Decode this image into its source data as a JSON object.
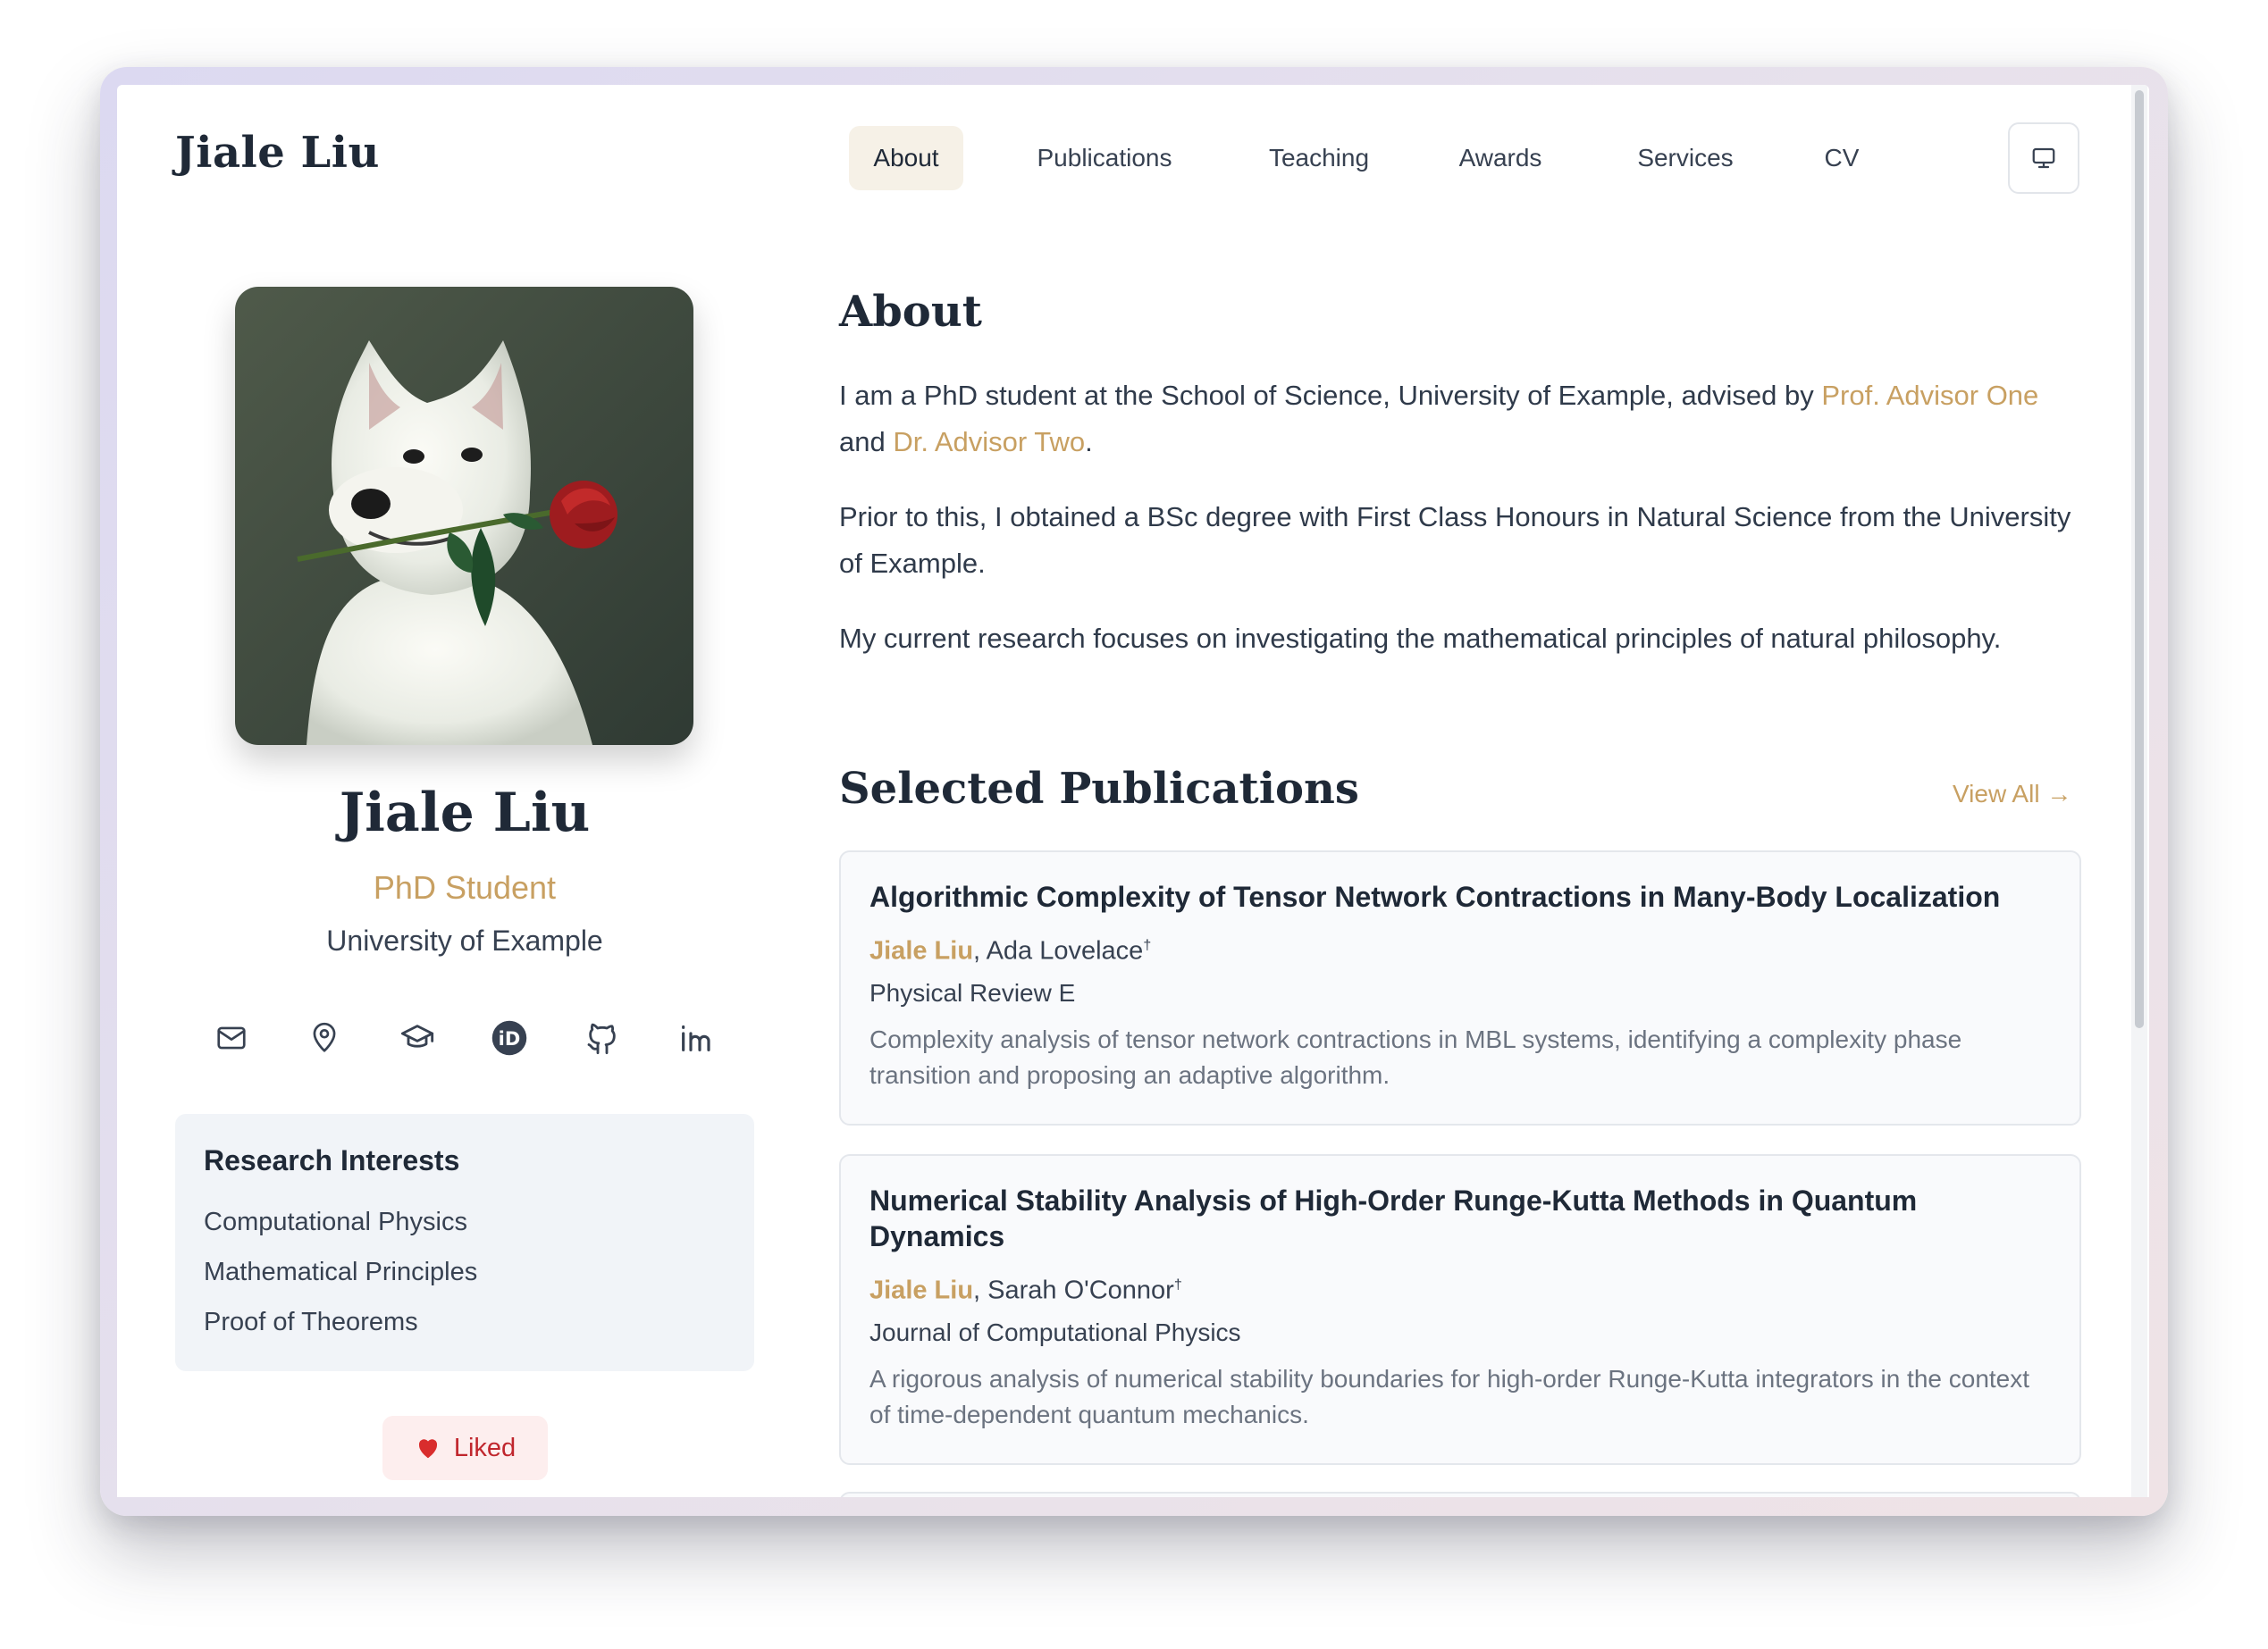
{
  "header": {
    "site_title": "Jiale Liu",
    "nav": [
      "About",
      "Publications",
      "Teaching",
      "Awards",
      "Services",
      "CV"
    ],
    "active_nav": "About",
    "theme_button_icon": "monitor-icon"
  },
  "profile": {
    "name": "Jiale Liu",
    "role": "PhD Student",
    "affiliation": "University of Example",
    "avatar_icon": "white-dog-with-rose",
    "social_icons": [
      "mail-icon",
      "location-pin-icon",
      "graduation-cap-icon",
      "orcid-icon",
      "github-icon",
      "linkedin-icon"
    ]
  },
  "interests": {
    "title": "Research Interests",
    "items": [
      "Computational Physics",
      "Mathematical Principles",
      "Proof of Theorems"
    ]
  },
  "liked": {
    "label": "Liked",
    "icon": "heart-icon"
  },
  "about": {
    "title": "About",
    "p1_a": "I am a PhD student at the School of Science, University of Example, advised by ",
    "advisor1": "Prof. Advisor One",
    "p1_and": " and ",
    "advisor2": "Dr. Advisor Two",
    "p1_end": ".",
    "p2": "Prior to this, I obtained a BSc degree with First Class Honours in Natural Science from the University of Example.",
    "p3": "My current research focuses on investigating the mathematical principles of natural philosophy."
  },
  "publications": {
    "title": "Selected Publications",
    "view_all": "View All →",
    "items": [
      {
        "title": "Algorithmic Complexity of Tensor Network Contractions in Many-Body Localization",
        "me": "Jiale Liu",
        "sep": ", ",
        "coauthor": "Ada Lovelace",
        "mark": "†",
        "venue": "Physical Review E",
        "abstract": "Complexity analysis of tensor network contractions in MBL systems, identifying a complexity phase transition and proposing an adaptive algorithm."
      },
      {
        "title": "Numerical Stability Analysis of High-Order Runge-Kutta Methods in Quantum Dynamics",
        "me": "Jiale Liu",
        "sep": ", ",
        "coauthor": "Sarah O'Connor",
        "mark": "†",
        "venue": "Journal of Computational Physics",
        "abstract": "A rigorous analysis of numerical stability boundaries for high-order Runge-Kutta integrators in the context of time-dependent quantum mechanics."
      }
    ]
  },
  "colors": {
    "accent": "#c8a062",
    "text": "#1f2937",
    "liked_red": "#c0262d"
  }
}
